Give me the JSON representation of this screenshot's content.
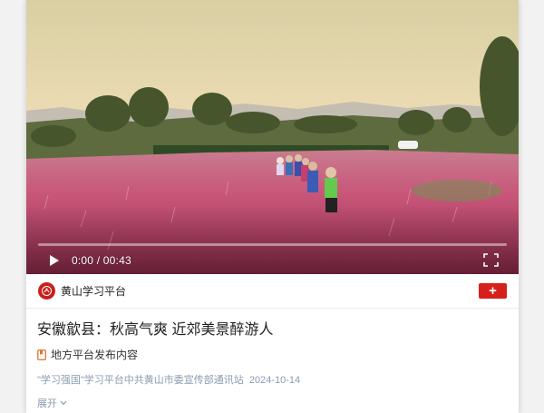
{
  "video": {
    "current_time": "0:00",
    "separator": "/",
    "duration": "00:43",
    "progress": 0.0,
    "play_icon": "play-icon",
    "fullscreen_icon": "fullscreen-icon"
  },
  "channel": {
    "name": "黄山学习平台",
    "follow_label": "+",
    "logo_icon": "channel-logo-icon",
    "accent_color": "#d5201b"
  },
  "article": {
    "title": "安徽歙县：秋高气爽 近郊美景醉游人",
    "source_label": "地方平台发布内容",
    "source_icon": "bookmark-icon",
    "meta_platform": "\"学习强国\"学习平台中共黄山市委宣传部通讯站",
    "meta_date": "2024-10-14",
    "expand_label": "展开"
  }
}
